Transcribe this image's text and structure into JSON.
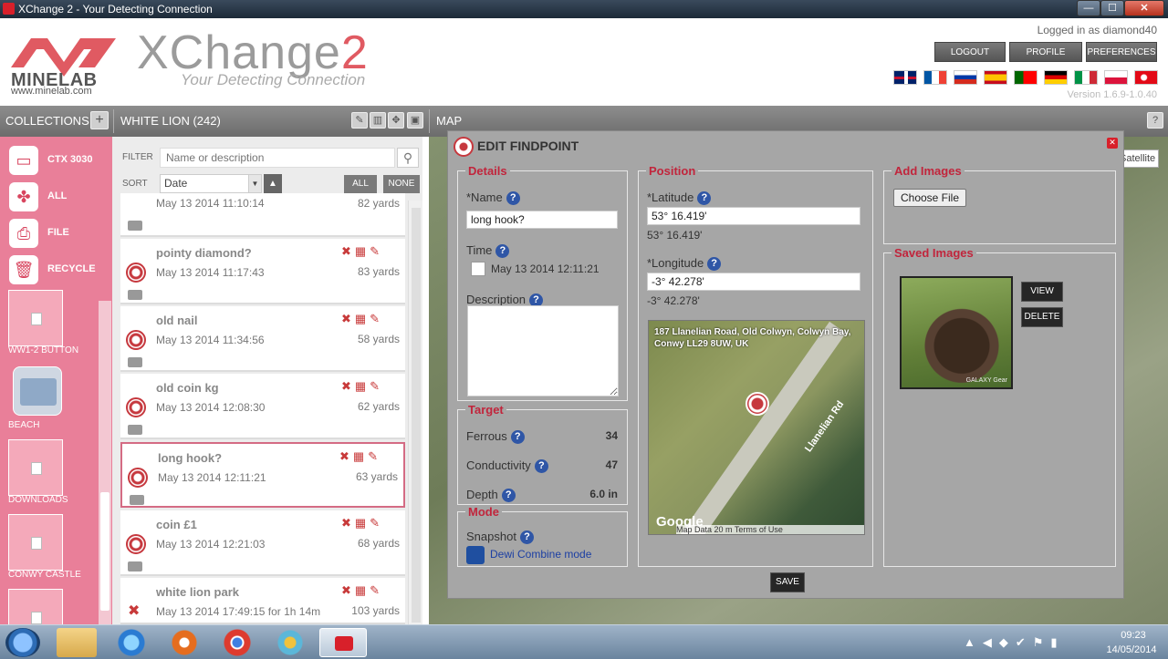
{
  "window": {
    "title": "XChange 2 - Your Detecting Connection",
    "minimize": "—",
    "maximize": "☐",
    "close": "✕"
  },
  "header": {
    "brand": "MINELAB",
    "brand_url": "www.minelab.com",
    "app_title_a": "XChange",
    "app_title_b": "2",
    "tagline": "Your Detecting Connection",
    "logged_in": "Logged in as diamond40",
    "logout": "LOGOUT",
    "profile": "PROFILE",
    "preferences": "PREFERENCES",
    "version": "Version 1.6.9-1.0.40",
    "flags": [
      "english-flag",
      "french-flag",
      "russian-flag",
      "spanish-flag",
      "portuguese-flag",
      "german-flag",
      "italian-flag",
      "polish-flag",
      "turkish-flag"
    ]
  },
  "toolbar": {
    "collections": "COLLECTIONS",
    "add": "+",
    "collection_name": "WHITE LION (242)",
    "map": "MAP",
    "help": "?"
  },
  "sidebar": {
    "devices": [
      {
        "label": "CTX 3030",
        "icon": "detector-icon"
      },
      {
        "label": "ALL",
        "icon": "all-icon"
      },
      {
        "label": "FILE",
        "icon": "file-icon"
      },
      {
        "label": "RECYCLE",
        "icon": "recycle-icon"
      }
    ],
    "collections": [
      "WW1-2 BUTTON",
      "BEACH",
      "DOWNLOADS",
      "CONWY CASTLE"
    ]
  },
  "list": {
    "filter_label": "FILTER",
    "filter_placeholder": "Name or description",
    "sort_label": "SORT",
    "sort_value": "Date",
    "all": "ALL",
    "none": "NONE",
    "items": [
      {
        "name": "",
        "date": "May 13 2014 11:10:14",
        "distance": "82 yards"
      },
      {
        "name": "pointy diamond?",
        "date": "May 13 2014 11:17:43",
        "distance": "83 yards"
      },
      {
        "name": "old nail",
        "date": "May 13 2014 11:34:56",
        "distance": "58 yards"
      },
      {
        "name": "old coin kg",
        "date": "May 13 2014 12:08:30",
        "distance": "62 yards"
      },
      {
        "name": "long hook?",
        "date": "May 13 2014 12:11:21",
        "distance": "63 yards"
      },
      {
        "name": "coin £1",
        "date": "May 13 2014 12:21:03",
        "distance": "68 yards"
      },
      {
        "name": "white lion park",
        "date": "May 13 2014 17:49:15 for 1h 14m",
        "distance": "103 yards"
      }
    ]
  },
  "map": {
    "satellite": "Satellite"
  },
  "dialog": {
    "title": "EDIT FINDPOINT",
    "details": {
      "legend": "Details",
      "name_label": "*Name",
      "name_value": "long hook?",
      "time_label": "Time",
      "time_value": "May 13 2014 12:11:21",
      "description_label": "Description"
    },
    "target": {
      "legend": "Target",
      "ferrous_label": "Ferrous",
      "ferrous_value": "34",
      "conductivity_label": "Conductivity",
      "conductivity_value": "47",
      "depth_label": "Depth",
      "depth_value": "6.0 in"
    },
    "mode": {
      "legend": "Mode",
      "snapshot_label": "Snapshot",
      "snapshot_value": "Dewi Combine mode"
    },
    "position": {
      "legend": "Position",
      "latitude_label": "*Latitude",
      "latitude_value": "53° 16.419'",
      "latitude_display": "53° 16.419'",
      "longitude_label": "*Longitude",
      "longitude_value": "-3° 42.278'",
      "longitude_display": "-3° 42.278'",
      "map_address": "187 Llanelian Road, Old Colwyn, Colwyn Bay, Conwy LL29 8UW, UK",
      "road_label": "Llanelian Rd",
      "map_attribution": "Map Data   20 m        Terms of Use",
      "google": "Google"
    },
    "add_images": {
      "legend": "Add Images",
      "choose_file": "Choose File"
    },
    "saved_images": {
      "legend": "Saved Images",
      "view": "VIEW",
      "delete": "DELETE",
      "watermark": "GALAXY Gear"
    },
    "save": "SAVE"
  },
  "taskbar": {
    "time": "09:23",
    "date": "14/05/2014"
  },
  "colors": {
    "accent_pink": "#e97f99",
    "legend_red": "#c1253c",
    "brand_red": "#d8202a"
  }
}
